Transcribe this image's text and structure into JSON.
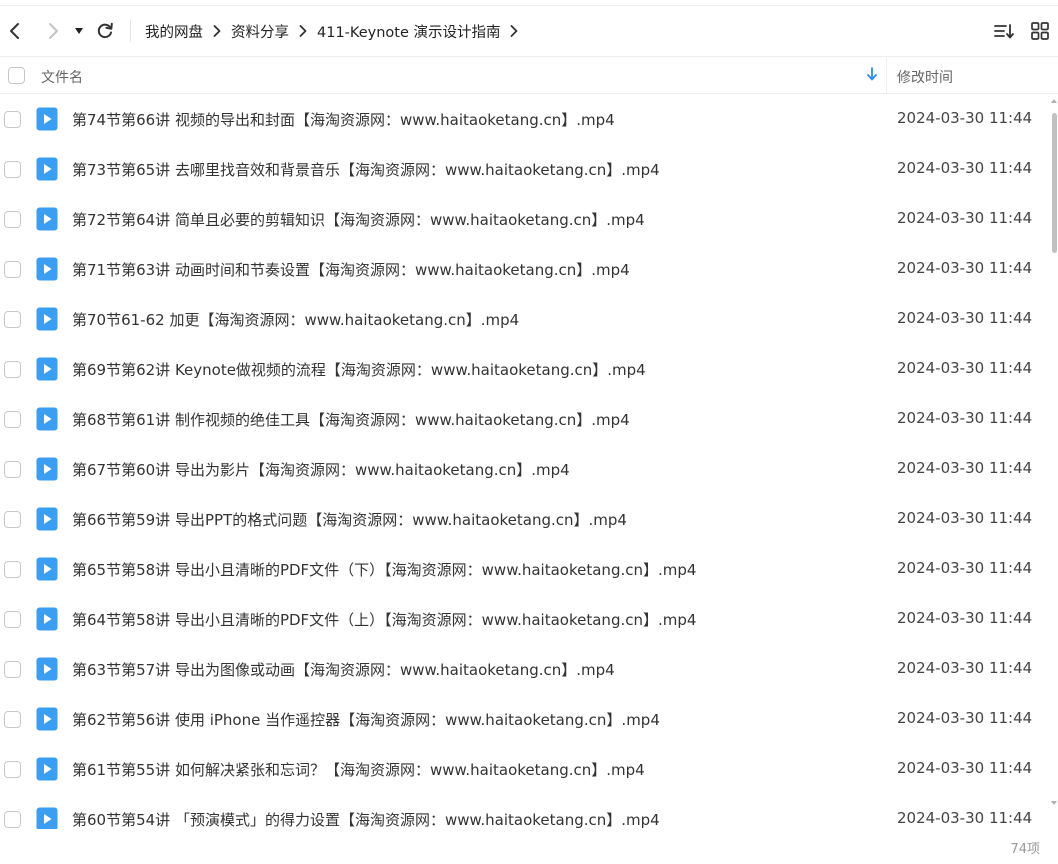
{
  "toolbar": {
    "breadcrumb": [
      {
        "label": "我的网盘"
      },
      {
        "label": "资料分享"
      },
      {
        "label": "411-Keynote 演示设计指南"
      }
    ]
  },
  "header": {
    "name_label": "文件名",
    "time_label": "修改时间"
  },
  "files": [
    {
      "name": "第74节第66讲 视频的导出和封面【海淘资源网：www.haitaoketang.cn】.mp4",
      "time": "2024-03-30 11:44"
    },
    {
      "name": "第73节第65讲 去哪里找音效和背景音乐【海淘资源网：www.haitaoketang.cn】.mp4",
      "time": "2024-03-30 11:44"
    },
    {
      "name": "第72节第64讲 简单且必要的剪辑知识【海淘资源网：www.haitaoketang.cn】.mp4",
      "time": "2024-03-30 11:44"
    },
    {
      "name": "第71节第63讲 动画时间和节奏设置【海淘资源网：www.haitaoketang.cn】.mp4",
      "time": "2024-03-30 11:44"
    },
    {
      "name": "第70节61-62 加更【海淘资源网：www.haitaoketang.cn】.mp4",
      "time": "2024-03-30 11:44"
    },
    {
      "name": "第69节第62讲 Keynote做视频的流程【海淘资源网：www.haitaoketang.cn】.mp4",
      "time": "2024-03-30 11:44"
    },
    {
      "name": "第68节第61讲 制作视频的绝佳工具【海淘资源网：www.haitaoketang.cn】.mp4",
      "time": "2024-03-30 11:44"
    },
    {
      "name": "第67节第60讲 导出为影片【海淘资源网：www.haitaoketang.cn】.mp4",
      "time": "2024-03-30 11:44"
    },
    {
      "name": "第66节第59讲 导出PPT的格式问题【海淘资源网：www.haitaoketang.cn】.mp4",
      "time": "2024-03-30 11:44"
    },
    {
      "name": "第65节第58讲 导出小且清晰的PDF文件（下）【海淘资源网：www.haitaoketang.cn】.mp4",
      "time": "2024-03-30 11:44"
    },
    {
      "name": "第64节第58讲 导出小且清晰的PDF文件（上）【海淘资源网：www.haitaoketang.cn】.mp4",
      "time": "2024-03-30 11:44"
    },
    {
      "name": "第63节第57讲 导出为图像或动画【海淘资源网：www.haitaoketang.cn】.mp4",
      "time": "2024-03-30 11:44"
    },
    {
      "name": "第62节第56讲 使用 iPhone 当作遥控器【海淘资源网：www.haitaoketang.cn】.mp4",
      "time": "2024-03-30 11:44"
    },
    {
      "name": "第61节第55讲 如何解决紧张和忘词？【海淘资源网：www.haitaoketang.cn】.mp4",
      "time": "2024-03-30 11:44"
    },
    {
      "name": "第60节第54讲 「预演模式」的得力设置【海淘资源网：www.haitaoketang.cn】.mp4",
      "time": "2024-03-30 11:44"
    }
  ],
  "footer": {
    "item_count": "74项"
  },
  "icons": {
    "back": "chevron-left-icon",
    "forward": "chevron-right-icon",
    "dropdown": "caret-down-icon",
    "refresh": "refresh-icon",
    "sort": "sort-list-icon",
    "grid": "grid-view-icon",
    "file": "video-file-icon",
    "sort_arrow": "arrow-down-icon"
  },
  "colors": {
    "file_icon": "#3a9ef5",
    "sort_arrow": "#2a8ef0"
  }
}
